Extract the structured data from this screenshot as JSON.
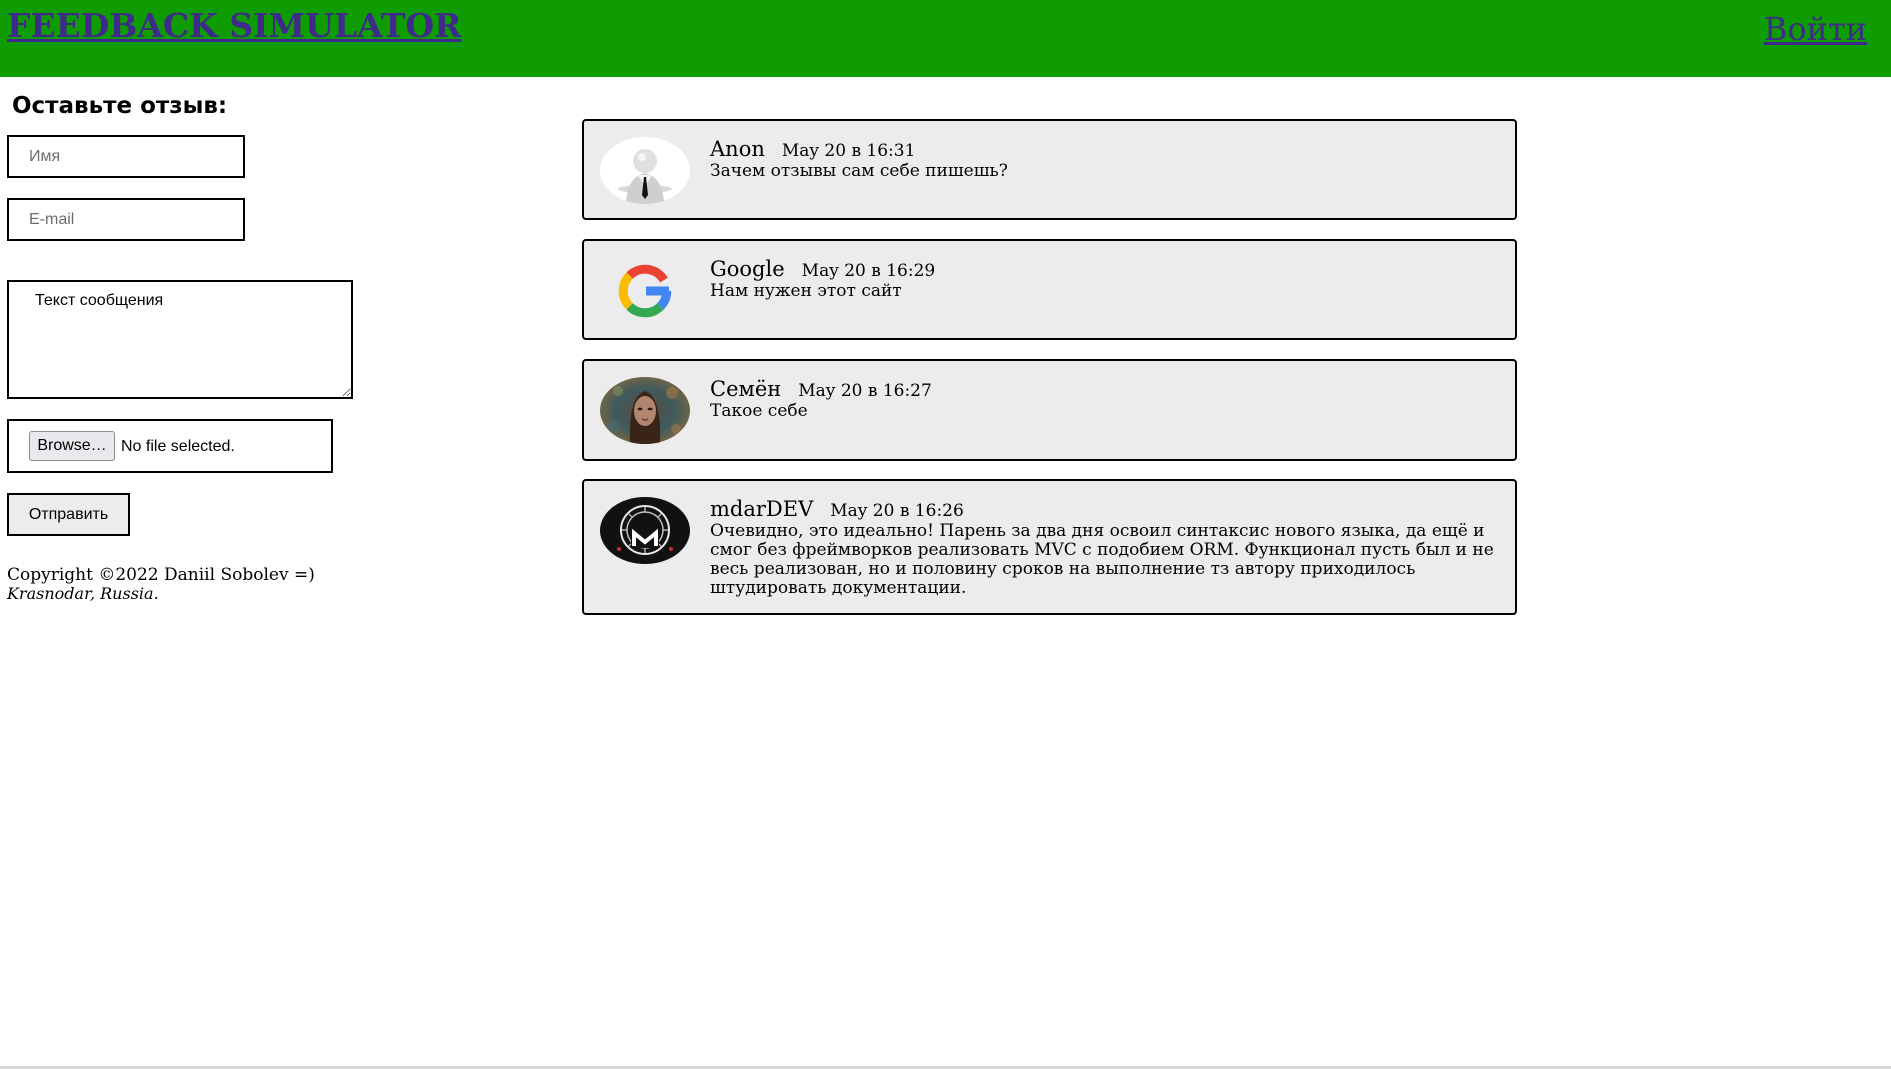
{
  "header": {
    "title": "FEEDBACK SIMULATOR",
    "login_label": "Войти",
    "background_color": "#0e9c00",
    "link_color": "#3e2a8a"
  },
  "form": {
    "heading": "Оставьте отзыв:",
    "name_placeholder": "Имя",
    "email_placeholder": "E-mail",
    "message_placeholder": "Текст сообщения",
    "browse_label": "Browse…",
    "file_status": "No file selected.",
    "submit_label": "Отправить"
  },
  "footer": {
    "copyright": "Copyright ©2022 Daniil Sobolev =)",
    "location": "Krasnodar, Russia."
  },
  "reviews": [
    {
      "author": "Anon",
      "date": "May 20 в 16:31",
      "text": "Зачем отзывы сам себе пишешь?",
      "avatar_icon": "faceless-person-avatar-icon"
    },
    {
      "author": "Google",
      "date": "May 20 в 16:29",
      "text": "Нам нужен этот сайт",
      "avatar_icon": "google-logo-avatar-icon"
    },
    {
      "author": "Семён",
      "date": "May 20 в 16:27",
      "text": "Такое себе",
      "avatar_icon": "portrait-avatar-icon"
    },
    {
      "author": "mdarDEV",
      "date": "May 20 в 16:26",
      "text": "Очевидно, это идеально! Парень за два дня освоил синтаксис нового языка, да ещё и смог без фреймворков реализовать MVC с подобием ORM. Функционал пусть был и не весь реализован, но и половину сроков на выполнение тз автору приходилось штудировать документации.",
      "avatar_icon": "mdardev-logo-avatar-icon"
    }
  ]
}
